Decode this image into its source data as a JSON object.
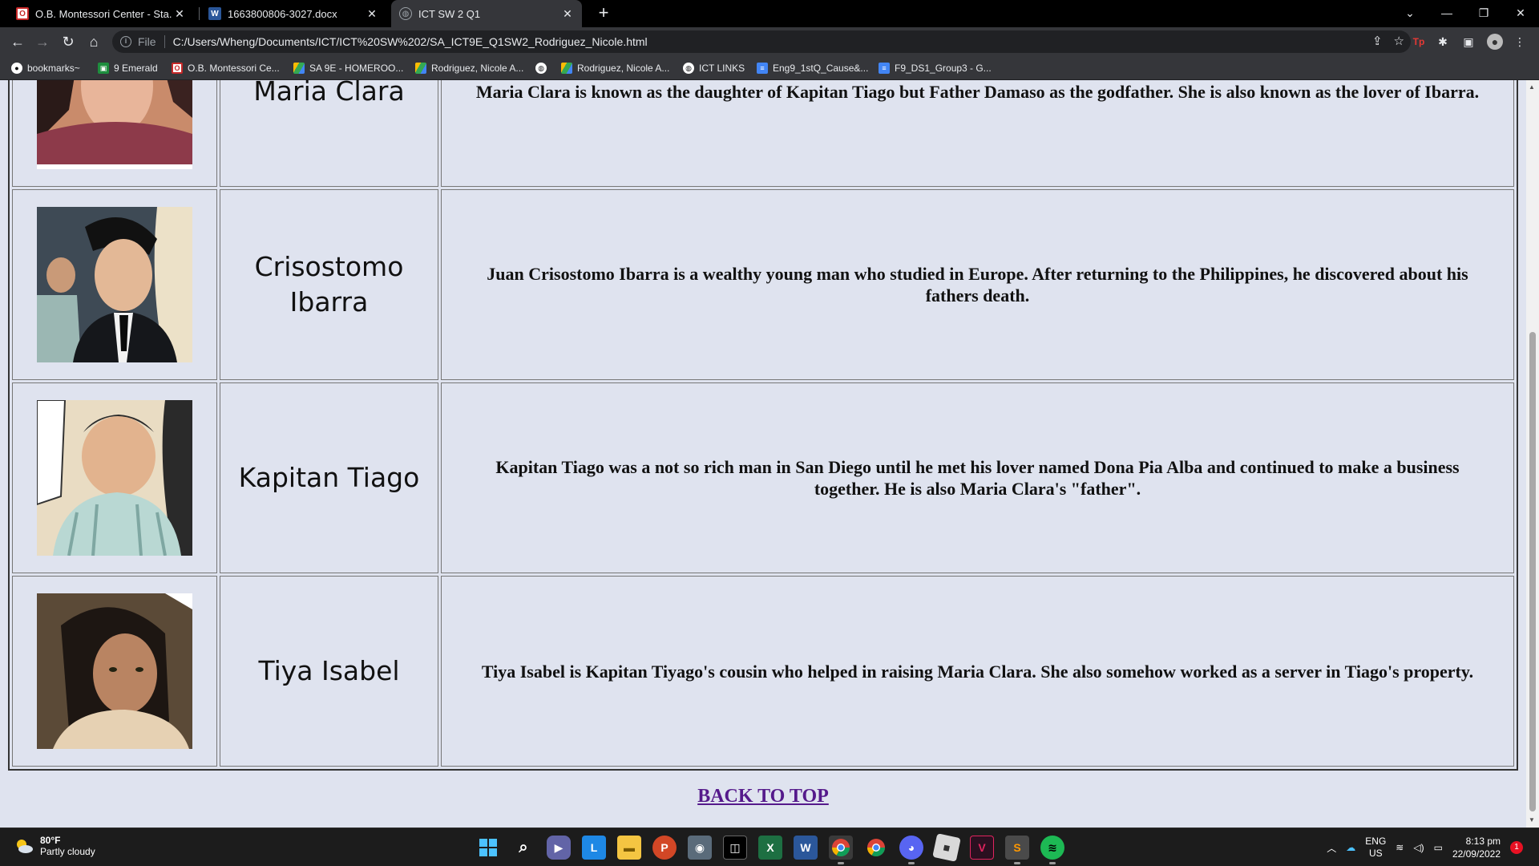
{
  "browser": {
    "tabs": [
      {
        "title": "O.B. Montessori Center - Sta. Ana",
        "icon": "obmc-favicon",
        "active": false
      },
      {
        "title": "1663800806-3027.docx",
        "icon": "word-favicon",
        "active": false
      },
      {
        "title": "ICT SW 2 Q1",
        "icon": "globe-favicon",
        "active": true
      }
    ],
    "new_tab_label": "+",
    "address": {
      "scheme": "File",
      "url": "C:/Users/Wheng/Documents/ICT/ICT%20SW%202/SA_ICT9E_Q1SW2_Rodriguez_Nicole.html"
    },
    "bookmarks": [
      {
        "label": "bookmarks~",
        "icon": "github-icon"
      },
      {
        "label": "9 Emerald",
        "icon": "google-classroom-icon"
      },
      {
        "label": "O.B. Montessori Ce...",
        "icon": "obmc-icon"
      },
      {
        "label": "SA 9E - HOMEROO...",
        "icon": "drive-icon"
      },
      {
        "label": "Rodriguez, Nicole A...",
        "icon": "drive-icon"
      },
      {
        "label": "",
        "icon": "globe-icon"
      },
      {
        "label": "Rodriguez, Nicole A...",
        "icon": "drive-icon"
      },
      {
        "label": "ICT LINKS",
        "icon": "globe-icon"
      },
      {
        "label": "Eng9_1stQ_Cause&...",
        "icon": "docs-icon"
      },
      {
        "label": "F9_DS1_Group3 - G...",
        "icon": "docs-icon"
      }
    ]
  },
  "page": {
    "partial_top": {
      "name": "Maria Clara",
      "description": "Maria Clara is known as the daughter of Kapitan Tiago but Father Damaso as the godfather. She is also known as the lover of Ibarra."
    },
    "characters": [
      {
        "name": "Crisostomo Ibarra",
        "description": "Juan Crisostomo Ibarra is a wealthy young man who studied in Europe. After returning to the Philippines, he discovered about his fathers death."
      },
      {
        "name": "Kapitan Tiago",
        "description": "Kapitan Tiago was a not so rich man in San Diego until he met his lover named Dona Pia Alba and continued to make a business together. He is also Maria Clara's \"father\"."
      },
      {
        "name": "Tiya Isabel",
        "description": "Tiya Isabel is Kapitan Tiyago's cousin who helped in raising Maria Clara. She also somehow worked as a server in Tiago's property."
      }
    ],
    "back_to_top": "BACK TO TOP"
  },
  "taskbar": {
    "weather": {
      "temp": "80°F",
      "condition": "Partly cloudy"
    },
    "apps": [
      "windows-start",
      "search",
      "teams-chat",
      "lexi",
      "file-explorer",
      "powerpoint",
      "camera",
      "roblox-studio",
      "excel",
      "word",
      "chrome",
      "chrome-alt",
      "discord",
      "roblox",
      "vivaldi",
      "sublime",
      "spotify"
    ],
    "tray": {
      "lang1": "ENG",
      "lang2": "US"
    },
    "clock": {
      "time": "8:13 pm",
      "date": "22/09/2022"
    },
    "notifications": "1"
  }
}
